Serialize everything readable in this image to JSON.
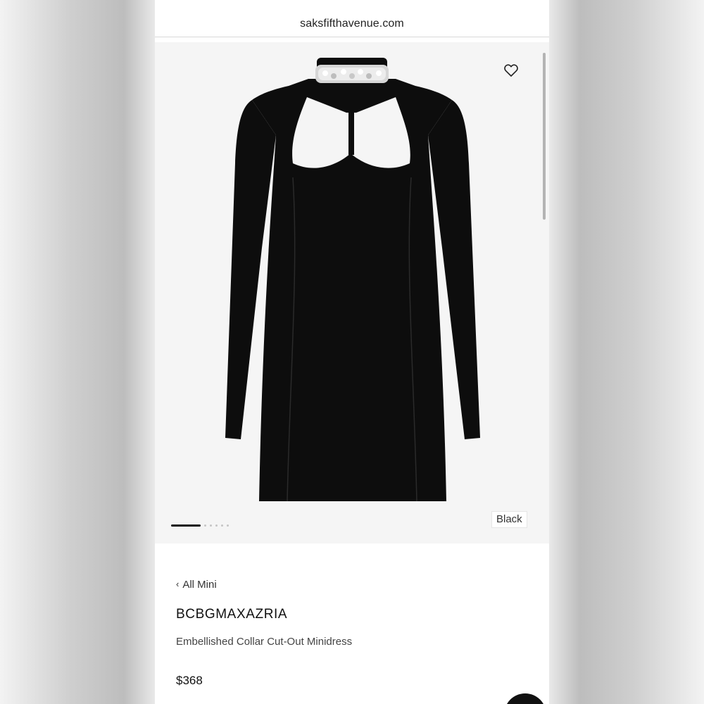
{
  "browser": {
    "url": "saksfifthavenue.com"
  },
  "gallery": {
    "wishlist_icon": "heart-outline-icon",
    "image_count": 6,
    "active_image_index": 0,
    "color_label": "Black"
  },
  "product": {
    "back_link_chevron": "‹",
    "back_link_label": "All Mini",
    "brand": "BCBGMAXAZRIA",
    "name": "Embellished Collar Cut-Out Minidress",
    "price": "$368"
  },
  "colors": {
    "dress": "#0d0d0d",
    "gallery_bg": "#f5f5f5"
  }
}
